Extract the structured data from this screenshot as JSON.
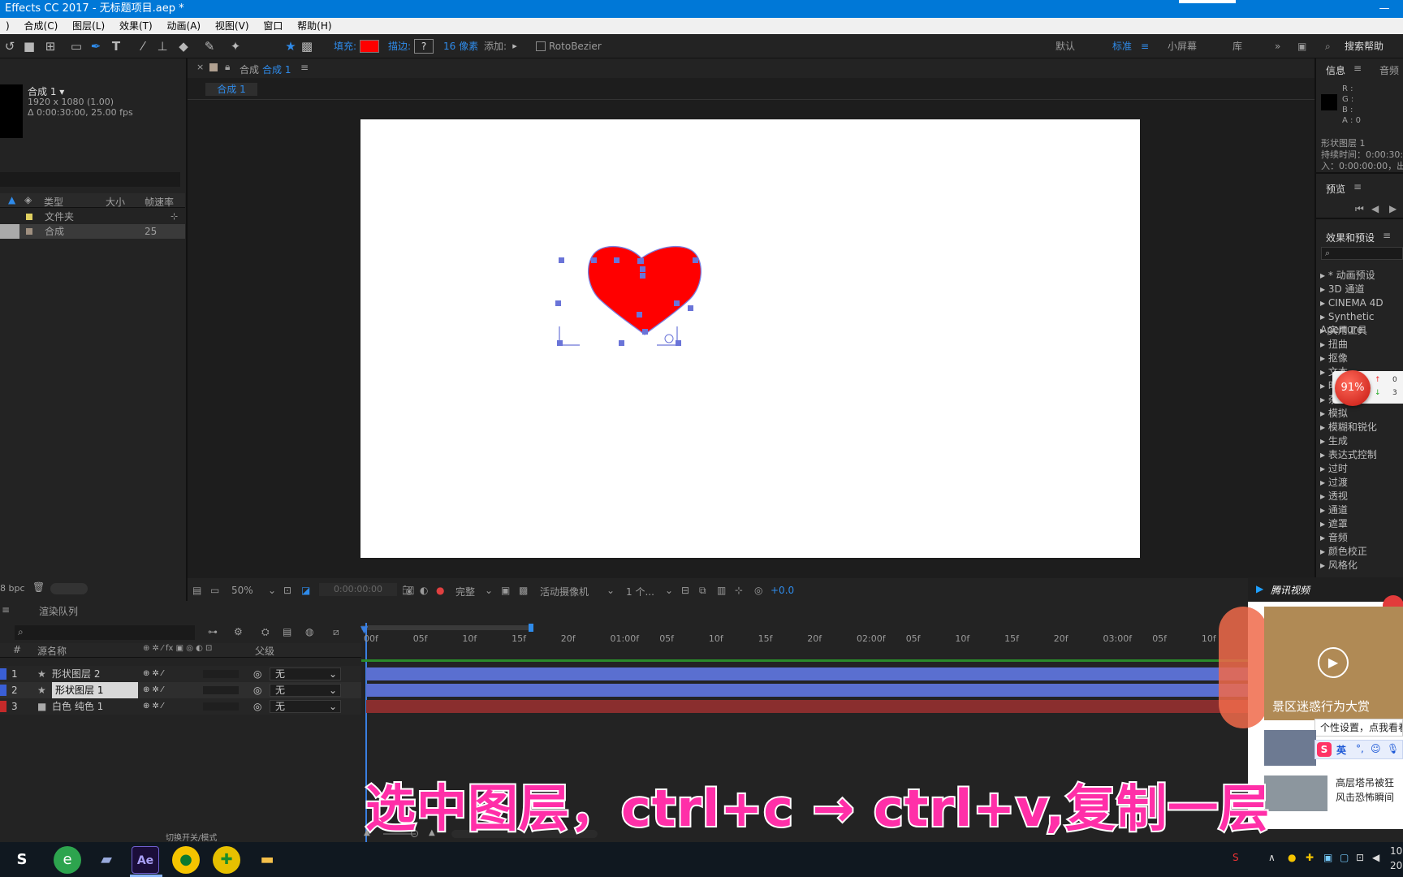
{
  "window": {
    "title": "Effects CC 2017 - 无标题项目.aep *"
  },
  "menu": [
    "合成(C)",
    "图层(L)",
    "效果(T)",
    "动画(A)",
    "视图(V)",
    "窗口",
    "帮助(H)"
  ],
  "toolbar": {
    "fill_label": "填充:",
    "stroke_label": "描边:",
    "stroke_val": "?",
    "stroke_px": "16 像素",
    "add_label": "添加:",
    "rotobezier": "RotoBezier",
    "workspaces": [
      "默认",
      "标准",
      "小屏幕",
      "库"
    ],
    "search": "搜索帮助",
    "fill_color": "#ff0000"
  },
  "project": {
    "comp_name": "合成 1 ▾",
    "comp_res": "1920 x 1080 (1.00)",
    "comp_dur": "Δ 0:00:30:00, 25.00 fps",
    "col_type": "类型",
    "col_size": "大小",
    "col_fps": "帧速率",
    "items": [
      {
        "name": "文件夹",
        "fps": ""
      },
      {
        "name": "合成",
        "fps": "25"
      }
    ],
    "bpc": "8 bpc"
  },
  "comp": {
    "tab_label": "合成",
    "tab_name": "合成 1",
    "sub_tab": "合成 1",
    "zoom": "50%",
    "time": "0:00:00:00",
    "quality": "完整",
    "camera": "活动摄像机",
    "views": "1 个...",
    "exposure": "+0.0"
  },
  "info": {
    "tab": "信息",
    "tab2": "音频",
    "r": "R :",
    "g": "G :",
    "b": "B :",
    "a": "A : 0",
    "layer": "形状图层 1",
    "duration": "持续时间：0:00:30:",
    "in": "入：0:00:00:00，出"
  },
  "preview": {
    "tab": "预览"
  },
  "effects": {
    "tab": "效果和预设",
    "items": [
      "* 动画预设",
      "3D 通道",
      "CINEMA 4D",
      "Synthetic Aperture",
      "实用工具",
      "扭曲",
      "抠像",
      "文本",
      "时间",
      "杂色",
      "模拟",
      "模糊和锐化",
      "生成",
      "表达式控制",
      "过时",
      "过渡",
      "透视",
      "通道",
      "遮罩",
      "音频",
      "颜色校正",
      "风格化"
    ]
  },
  "badge": {
    "pct": "91%",
    "up": "0",
    "down": "3"
  },
  "timeline": {
    "tab": "渲染队列",
    "col_num": "#",
    "col_name": "源名称",
    "col_parent": "父级",
    "toggle": "切换开关/模式",
    "ticks": [
      "00f",
      "05f",
      "10f",
      "15f",
      "20f",
      "01:00f",
      "05f",
      "10f",
      "15f",
      "20f",
      "02:00f",
      "05f",
      "10f",
      "15f",
      "20f",
      "03:00f",
      "05f",
      "10f"
    ],
    "layers": [
      {
        "num": "1",
        "name": "形状图层 2",
        "parent": "无",
        "color": "#3a5fd6",
        "bar": "#5a6fd0"
      },
      {
        "num": "2",
        "name": "形状图层 1",
        "parent": "无",
        "color": "#3a5fd6",
        "bar": "#5a6fd0"
      },
      {
        "num": "3",
        "name": "白色 纯色 1",
        "parent": "无",
        "color": "#c42a2a",
        "bar": "#8a2e2e"
      }
    ]
  },
  "tencent": {
    "brand": "腾讯视频",
    "headline": "景区迷惑行为大赏",
    "tip": "个性设置，点我看看",
    "news": "高层塔吊被狂风击恐怖瞬间",
    "ime": "英"
  },
  "subtitle": "选中图层，ctrl+c → ctrl+v,复制一层",
  "taskbar": {
    "clock_time": "10",
    "clock_date": "20"
  }
}
